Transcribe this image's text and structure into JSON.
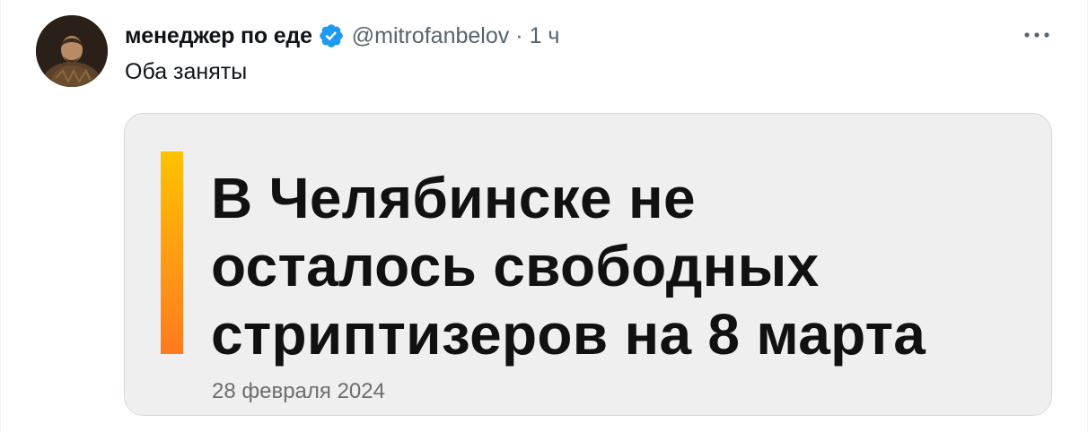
{
  "tweet": {
    "author": {
      "display_name": "менеджер по еде",
      "handle": "@mitrofanbelov",
      "verified": true,
      "avatar_icon": "avatar"
    },
    "separator": "·",
    "time": "1 ч",
    "more_icon": "more-icon",
    "text": "Оба заняты",
    "media": {
      "headline_lines": [
        "В Челябинске не",
        "осталось свободных",
        "стриптизеров на 8 марта"
      ],
      "date": "28 февраля 2024"
    }
  },
  "colors": {
    "verified": "#1d9bf0",
    "secondary_text": "#536471",
    "accent_bar_top": "#ffc200",
    "accent_bar_bottom": "#ff7a1f",
    "card_background": "#efefef"
  }
}
